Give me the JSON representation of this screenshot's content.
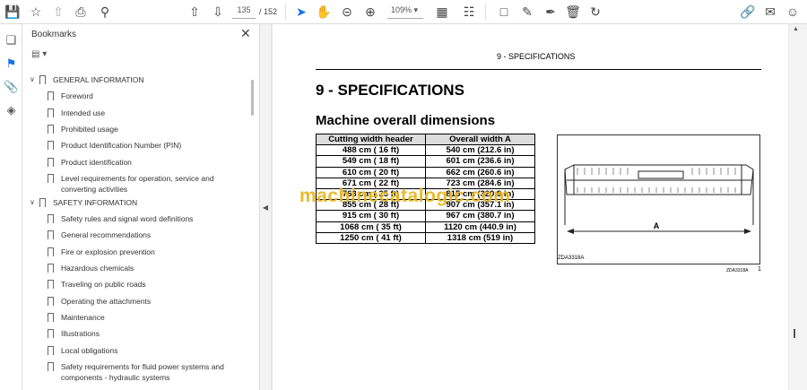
{
  "toolbar": {
    "page_current": "135",
    "page_total": "/ 152",
    "zoom": "109%"
  },
  "sidebar": {
    "title": "Bookmarks",
    "items": [
      {
        "label": "GENERAL INFORMATION",
        "level": 0
      },
      {
        "label": "Foreword",
        "level": 1
      },
      {
        "label": "Intended use",
        "level": 1
      },
      {
        "label": "Prohibited usage",
        "level": 1
      },
      {
        "label": "Product Identification Number (PIN)",
        "level": 1
      },
      {
        "label": "Product identification",
        "level": 1
      },
      {
        "label": "Level requirements for operation, service and converting activities",
        "level": 1
      },
      {
        "label": "SAFETY INFORMATION",
        "level": 0
      },
      {
        "label": "Safety rules and signal word definitions",
        "level": 1
      },
      {
        "label": "General recommendations",
        "level": 1
      },
      {
        "label": "Fire or explosion prevention",
        "level": 1
      },
      {
        "label": "Hazardous chemicals",
        "level": 1
      },
      {
        "label": "Traveling on public roads",
        "level": 1
      },
      {
        "label": "Operating the attachments",
        "level": 1
      },
      {
        "label": "Maintenance",
        "level": 1
      },
      {
        "label": "Illustrations",
        "level": 1
      },
      {
        "label": "Local obligations",
        "level": 1
      },
      {
        "label": "Safety requirements for fluid power systems and components - hydraulic systems",
        "level": 1
      }
    ]
  },
  "page": {
    "running_header": "9 - SPECIFICATIONS",
    "title": "9 - SPECIFICATIONS",
    "subtitle": "Machine overall dimensions",
    "table": {
      "headers": [
        "Cutting width header",
        "Overall width A"
      ],
      "rows": [
        [
          "488 cm ( 16 ft)",
          "540 cm (212.6 in)"
        ],
        [
          "549 cm ( 18 ft)",
          "601 cm (236.6 in)"
        ],
        [
          "610 cm ( 20 ft)",
          "662 cm (260.6 in)"
        ],
        [
          "671 cm ( 22 ft)",
          "723 cm (284.6 in)"
        ],
        [
          "763 cm ( 25 ft)",
          "815 cm (320.9 in)"
        ],
        [
          "855 cm ( 28 ft)",
          "907 cm (357.1 in)"
        ],
        [
          "915 cm ( 30 ft)",
          "967 cm (380.7 in)"
        ],
        [
          "1068 cm ( 35 ft)",
          "1120 cm (440.9 in)"
        ],
        [
          "1250 cm ( 41 ft)",
          "1318 cm (519 in)"
        ]
      ]
    },
    "figure": {
      "dimension_label": "A",
      "code": "ZDA3318A",
      "code_small": "ZDA3318A",
      "number": "1"
    },
    "watermark": "machinecatalogic.com"
  }
}
